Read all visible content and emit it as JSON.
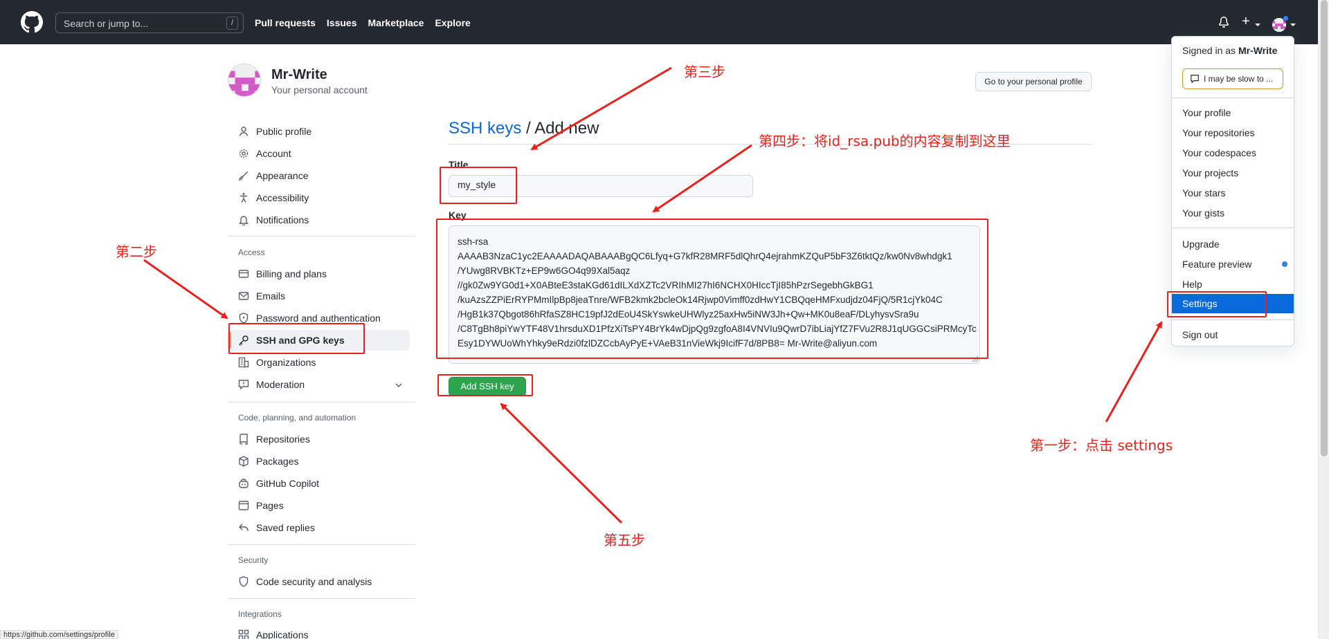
{
  "header": {
    "search_placeholder": "Search or jump to...",
    "search_shortcut": "/",
    "nav": [
      "Pull requests",
      "Issues",
      "Marketplace",
      "Explore"
    ],
    "plus_label": "+"
  },
  "account": {
    "name": "Mr-Write",
    "subtitle": "Your personal account",
    "profile_button": "Go to your personal profile"
  },
  "sidebar": {
    "items_top": [
      "Public profile",
      "Account",
      "Appearance",
      "Accessibility",
      "Notifications"
    ],
    "access_heading": "Access",
    "access_items": [
      "Billing and plans",
      "Emails",
      "Password and authentication",
      "SSH and GPG keys",
      "Organizations",
      "Moderation"
    ],
    "code_heading": "Code, planning, and automation",
    "code_items": [
      "Repositories",
      "Packages",
      "GitHub Copilot",
      "Pages",
      "Saved replies"
    ],
    "security_heading": "Security",
    "security_items": [
      "Code security and analysis"
    ],
    "integrations_heading": "Integrations",
    "integrations_items": [
      "Applications"
    ]
  },
  "main": {
    "breadcrumb_link": "SSH keys",
    "breadcrumb_sep": " / ",
    "breadcrumb_current": "Add new",
    "title_label": "Title",
    "title_value": "my_style",
    "key_label": "Key",
    "key_value": "ssh-rsa\nAAAAB3NzaC1yc2EAAAADAQABAAABgQC6Lfyq+G7kfR28MRF5dlQhrQ4ejrahmKZQuP5bF3Z6tktQz/kw0Nv8whdgk1\n/YUwg8RVBKTz+EP9w6GO4q99Xal5aqz\n//gk0Zw9YG0d1+X0ABteE3staKGd61dILXdXZTc2VRIhMI27hI6NCHX0HIccTjI85hPzrSegebhGkBG1\n/kuAzsZZPiErRYPMmIlpBp8jeaTnre/WFB2kmk2bcleOk14Rjwp0Vimff0zdHwY1CBQqeHMFxudjdz04FjQ/5R1cjYk04C\n/HgB1k37Qbgot86hRfaSZ8HC19pfJ2dEoU4SkYswkeUHWlyz25axHw5iNW3Jh+Qw+MK0u8eaF/DLyhysvSra9u\n/C8TgBh8piYwYTF48V1hrsduXD1PfzXiTsPY4BrYk4wDjpQg9zgfoA8I4VNVIu9QwrD7ibLiajYfZ7FVu2R8J1qUGGCsiPRMcyTc\nEsy1DYWUoWhYhky9eRdzi0fzlDZCcbAyPyE+VAeB31nVieWkj9IcifF7d/8PB8= Mr-Write@aliyun.com",
    "add_button": "Add SSH key"
  },
  "dropdown": {
    "signed_in_prefix": "Signed in as ",
    "signed_in_user": "Mr-Write",
    "status_text": "I may be slow to ...",
    "group1": [
      "Your profile",
      "Your repositories",
      "Your codespaces",
      "Your projects",
      "Your stars",
      "Your gists"
    ],
    "group2": [
      "Upgrade",
      "Feature preview",
      "Help",
      "Settings"
    ],
    "signout": "Sign out"
  },
  "status_url": "https://github.com/settings/profile",
  "annotations": {
    "step1": "第一步：点击 settings",
    "step2": "第二步",
    "step3": "第三步",
    "step4": "第四步：将id_rsa.pub的内容复制到这里",
    "step5": "第五步"
  },
  "colors": {
    "header_bg": "#24292f",
    "link": "#0969da",
    "button_green": "#2da44e",
    "annotation_red": "#e8211c",
    "selected_blue": "#0969da"
  }
}
